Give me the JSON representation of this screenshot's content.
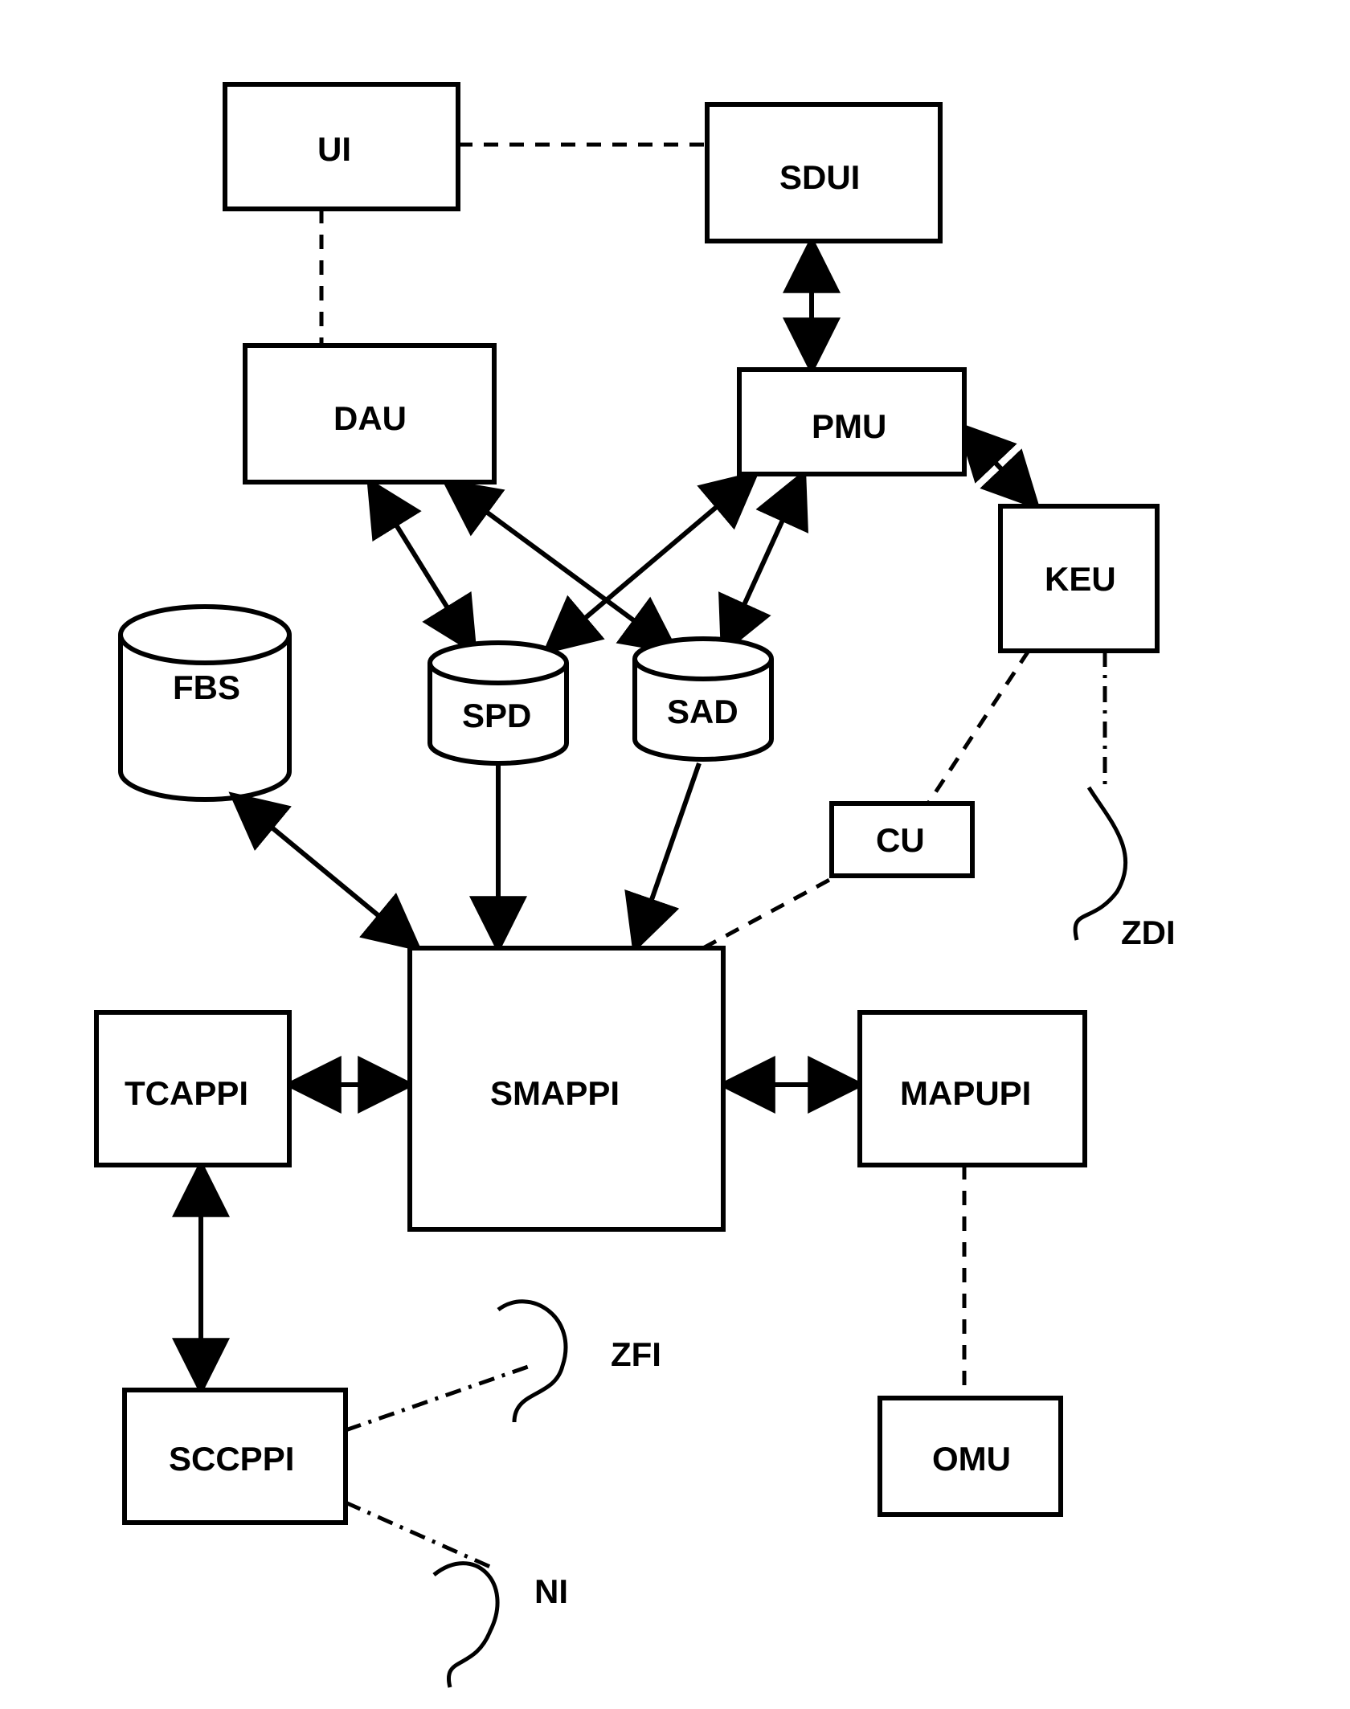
{
  "nodes": {
    "ui": "UI",
    "sdui": "SDUI",
    "dau": "DAU",
    "pmu": "PMU",
    "keu": "KEU",
    "fbs": "FBS",
    "spd": "SPD",
    "sad": "SAD",
    "cu": "CU",
    "zdi": "ZDI",
    "tcappi": "TCAPPI",
    "smappi": "SMAPPI",
    "mapupi": "MAPUPI",
    "omu": "OMU",
    "sccppi": "SCCPPI",
    "zfi": "ZFI",
    "ni": "NI"
  }
}
